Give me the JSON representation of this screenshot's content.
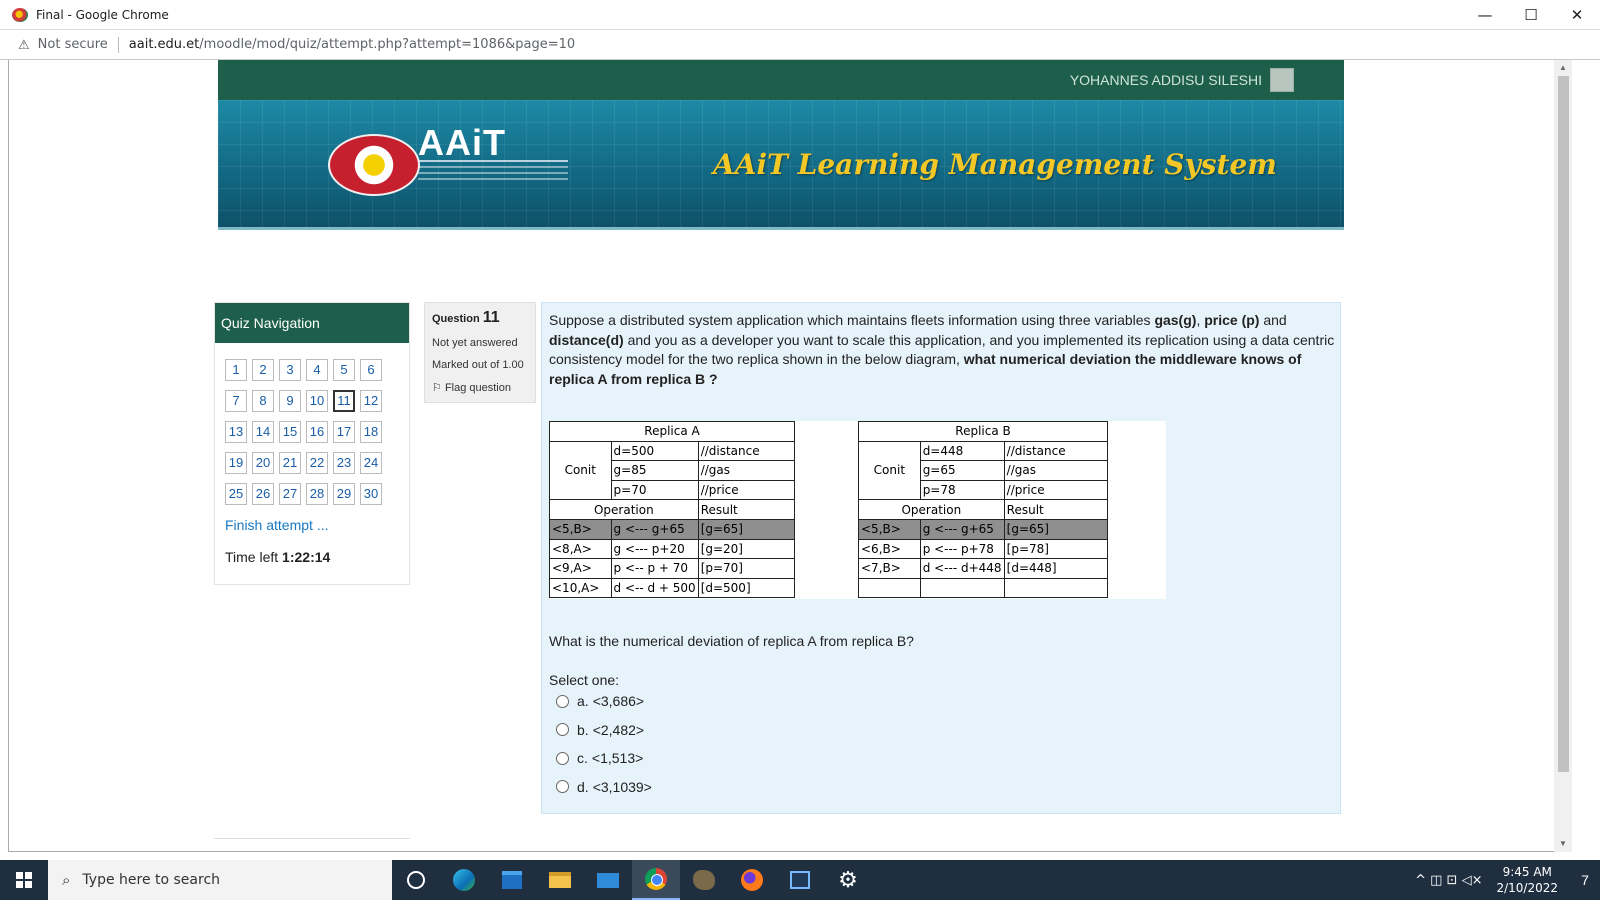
{
  "window": {
    "title": "Final - Google Chrome",
    "minimize_glyph": "—",
    "maximize_glyph": "☐",
    "close_glyph": "✕"
  },
  "address": {
    "security_label": "Not secure",
    "url_host": "aait.edu.et",
    "url_path": "/moodle/mod/quiz/attempt.php?attempt=1086&page=10"
  },
  "header": {
    "user_name": "YOHANNES ADDISU SILESHI",
    "logo_text": "AAiT",
    "site_title": "AAiT Learning Management System"
  },
  "quiz_nav": {
    "title": "Quiz Navigation",
    "questions": [
      "1",
      "2",
      "3",
      "4",
      "5",
      "6",
      "7",
      "8",
      "9",
      "10",
      "11",
      "12",
      "13",
      "14",
      "15",
      "16",
      "17",
      "18",
      "19",
      "20",
      "21",
      "22",
      "23",
      "24",
      "25",
      "26",
      "27",
      "28",
      "29",
      "30"
    ],
    "current": "11",
    "finish_label": "Finish attempt ...",
    "time_label": "Time left",
    "time_value": "1:22:14"
  },
  "question_info": {
    "label": "Question",
    "number": "11",
    "state": "Not yet answered",
    "marks": "Marked out of 1.00",
    "flag_label": "Flag question"
  },
  "question": {
    "text_parts": [
      {
        "t": "Suppose a distributed system application which maintains  fleets information   using three variables ",
        "b": false
      },
      {
        "t": "gas(g)",
        "b": true
      },
      {
        "t": ", ",
        "b": false
      },
      {
        "t": "price (p)",
        "b": true
      },
      {
        "t": " and ",
        "b": false
      },
      {
        "t": "distance(d)",
        "b": true
      },
      {
        "t": "  and you as a developer you want to scale this  application, and you implemented its replication using a data centric consistency model for the two replica shown in the below diagram,   ",
        "b": false
      },
      {
        "t": "what numerical deviation the middleware knows of replica A from replica B    ?",
        "b": true
      }
    ],
    "sub_question": "What is the numerical deviation of replica A  from replica B?",
    "select_label": "Select one:",
    "options": [
      {
        "letter": "a.",
        "text": "<3,686>"
      },
      {
        "letter": "b.",
        "text": "<2,482>"
      },
      {
        "letter": "c.",
        "text": "<1,513>"
      },
      {
        "letter": "d.",
        "text": "<3,1039>"
      }
    ]
  },
  "replica_a": {
    "title": "Replica A",
    "conit_label": "Conit",
    "conit": [
      [
        "d=500",
        "//distance"
      ],
      [
        "g=85",
        "//gas"
      ],
      [
        "p=70",
        "//price"
      ]
    ],
    "op_header": "Operation",
    "result_header": "Result",
    "ops": [
      [
        "<5,B>",
        "g <--- g+65",
        "[g=65]"
      ],
      [
        "<8,A>",
        "g <--- p+20",
        "[g=20]"
      ],
      [
        "<9,A>",
        "p <-- p + 70",
        "[p=70]"
      ],
      [
        "<10,A>",
        "d <-- d + 500",
        "[d=500]"
      ]
    ]
  },
  "replica_b": {
    "title": "Replica B",
    "conit_label": "Conit",
    "conit": [
      [
        "d=448",
        "//distance"
      ],
      [
        "g=65",
        "//gas"
      ],
      [
        "p=78",
        "//price"
      ]
    ],
    "op_header": "Operation",
    "result_header": "Result",
    "ops": [
      [
        "<5,B>",
        "g <--- g+65",
        "[g=65]"
      ],
      [
        "<6,B>",
        "p <--- p+78",
        "[p=78]"
      ],
      [
        "<7,B>",
        "d <--- d+448",
        "[d=448]"
      ],
      [
        "",
        "",
        ""
      ]
    ]
  },
  "taskbar": {
    "search_placeholder": "Type here to search",
    "time": "9:45 AM",
    "date": "2/10/2022",
    "notification_count": "7",
    "tray_glyphs": "^  ◫  ⊡  ◁×"
  },
  "colors": {
    "moodle_green": "#1d5f4a",
    "banner_blue": "#136a85",
    "link_blue": "#1a78c2",
    "question_bg": "#e7f3fb"
  }
}
